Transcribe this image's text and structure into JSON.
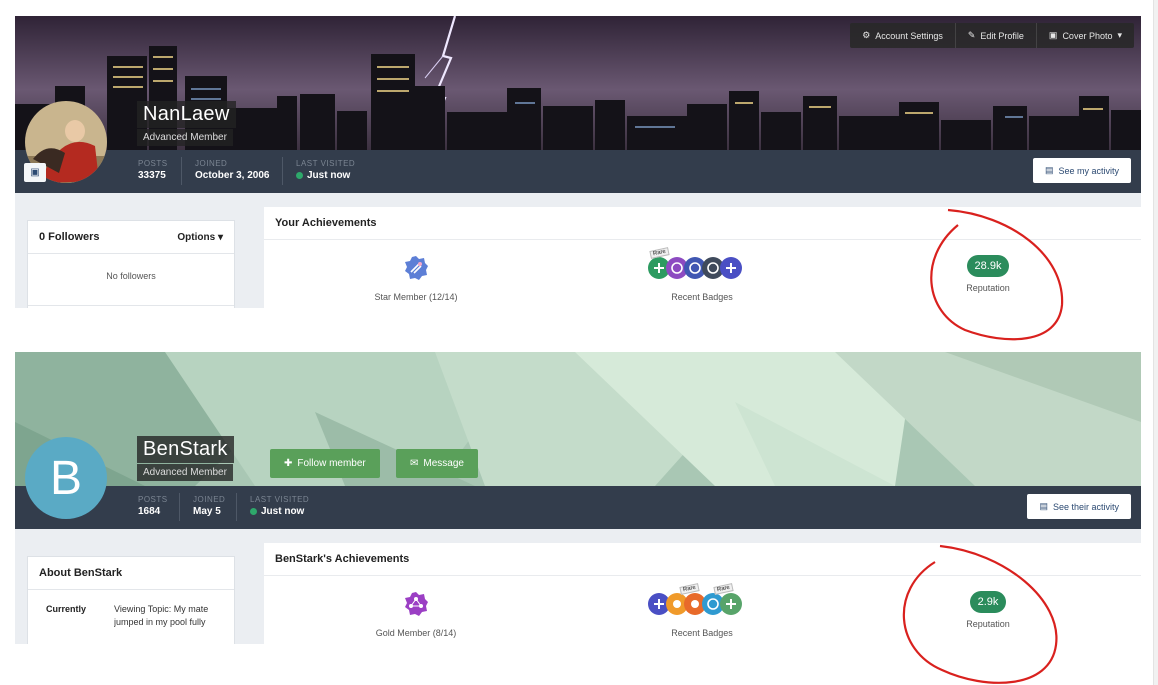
{
  "profile_one": {
    "name": "NanLaew",
    "rank": "Advanced Member",
    "top_buttons": [
      "Account Settings",
      "Edit Profile",
      "Cover Photo"
    ],
    "stats": [
      {
        "label": "POSTS",
        "value": "33375"
      },
      {
        "label": "JOINED",
        "value": "October 3, 2006"
      },
      {
        "label": "LAST VISITED",
        "value": "Just now"
      }
    ],
    "activity_button": "See my activity",
    "followers_title": "0 Followers",
    "options_label": "Options",
    "no_followers": "No followers",
    "achievements_title": "Your Achievements",
    "achievements": {
      "rank_caption": "Star Member (12/14)",
      "badges_caption": "Recent Badges",
      "rare_tag": "Rare",
      "reputation_value": "28.9k",
      "reputation_caption": "Reputation"
    }
  },
  "profile_two": {
    "name": "BenStark",
    "rank": "Advanced Member",
    "avatar_letter": "B",
    "follow_button": "Follow member",
    "message_button": "Message",
    "stats": [
      {
        "label": "POSTS",
        "value": "1684"
      },
      {
        "label": "JOINED",
        "value": "May 5"
      },
      {
        "label": "LAST VISITED",
        "value": "Just now"
      }
    ],
    "activity_button": "See their activity",
    "about_title": "About BenStark",
    "about_key": "Currently",
    "about_value": "Viewing Topic: My mate jumped in my pool fully clothed, said he mat",
    "achievements_title": "BenStark's Achievements",
    "achievements": {
      "rank_caption": "Gold Member (8/14)",
      "badges_caption": "Recent Badges",
      "rare_tag": "Rare",
      "reputation_value": "2.9k",
      "reputation_caption": "Reputation"
    }
  },
  "colors": {
    "infobar": "#333d4c",
    "reputation_green": "#2b8c5c",
    "follow_green": "#5aa05a",
    "annotation_red": "#d9211e"
  }
}
